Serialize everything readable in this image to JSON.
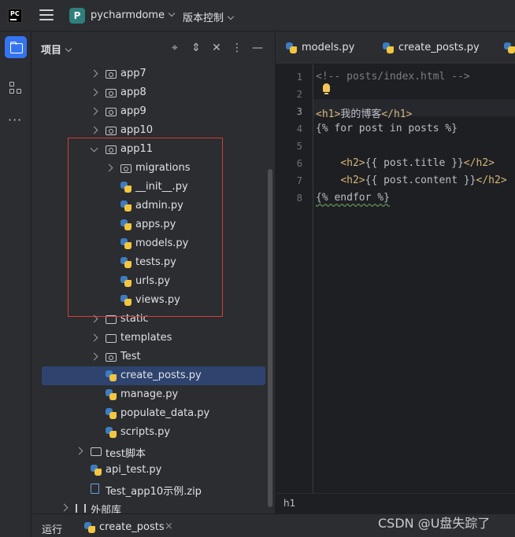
{
  "titlebar": {
    "logo_text": "PC",
    "project_badge": "P",
    "project_name": "pycharmdome",
    "vcs_label": "版本控制"
  },
  "panel": {
    "title": "项目",
    "icons": [
      "crosshair-icon",
      "expand-icon",
      "collapse-icon",
      "more-icon",
      "minimize-icon"
    ]
  },
  "tree": [
    {
      "label": "app7",
      "type": "module-folder",
      "expanded": false
    },
    {
      "label": "app8",
      "type": "module-folder",
      "expanded": false
    },
    {
      "label": "app9",
      "type": "module-folder",
      "expanded": false
    },
    {
      "label": "app10",
      "type": "module-folder",
      "expanded": false
    },
    {
      "label": "app11",
      "type": "module-folder",
      "expanded": true
    },
    {
      "label": "migrations",
      "type": "module-folder",
      "expanded": false
    },
    {
      "label": "__init__.py",
      "type": "py"
    },
    {
      "label": "admin.py",
      "type": "py"
    },
    {
      "label": "apps.py",
      "type": "py"
    },
    {
      "label": "models.py",
      "type": "py"
    },
    {
      "label": "tests.py",
      "type": "py"
    },
    {
      "label": "urls.py",
      "type": "py"
    },
    {
      "label": "views.py",
      "type": "py"
    },
    {
      "label": "static",
      "type": "folder",
      "expanded": false
    },
    {
      "label": "templates",
      "type": "folder",
      "expanded": false
    },
    {
      "label": "Test",
      "type": "module-folder",
      "expanded": false
    },
    {
      "label": "create_posts.py",
      "type": "py",
      "selected": true
    },
    {
      "label": "manage.py",
      "type": "py"
    },
    {
      "label": "populate_data.py",
      "type": "py"
    },
    {
      "label": "scripts.py",
      "type": "py"
    },
    {
      "label": "test脚本",
      "type": "folder",
      "expanded": false
    },
    {
      "label": "api_test.py",
      "type": "py"
    },
    {
      "label": "Test_app10示例.zip",
      "type": "zip"
    },
    {
      "label": "外部库",
      "type": "library",
      "expanded": false
    }
  ],
  "editor": {
    "tabs": [
      {
        "label": "models.py"
      },
      {
        "label": "create_posts.py"
      }
    ],
    "current_line": 3,
    "lines": [
      {
        "n": "1",
        "text": "<!-- posts/index.html -->"
      },
      {
        "n": "2",
        "text": ""
      },
      {
        "n": "3",
        "text": "<h1>我的博客</h1>"
      },
      {
        "n": "4",
        "text": "{% for post in posts %}"
      },
      {
        "n": "5",
        "text": ""
      },
      {
        "n": "6",
        "text": "    <h2>{{ post.title }}</h2>"
      },
      {
        "n": "7",
        "text": "    <h2>{{ post.content }}</h2>"
      },
      {
        "n": "8",
        "text": "{% endfor %}"
      }
    ],
    "breadcrumb": "h1"
  },
  "bottombar": {
    "run_label": "运行",
    "run_tab": "create_posts",
    "close_glyph": "×"
  },
  "watermark": "CSDN @U盘失踪了",
  "colors": {
    "accent": "#3574f0",
    "selection": "#2e436e",
    "highlight_box": "#d63b3b",
    "tag": "#d5b778"
  }
}
